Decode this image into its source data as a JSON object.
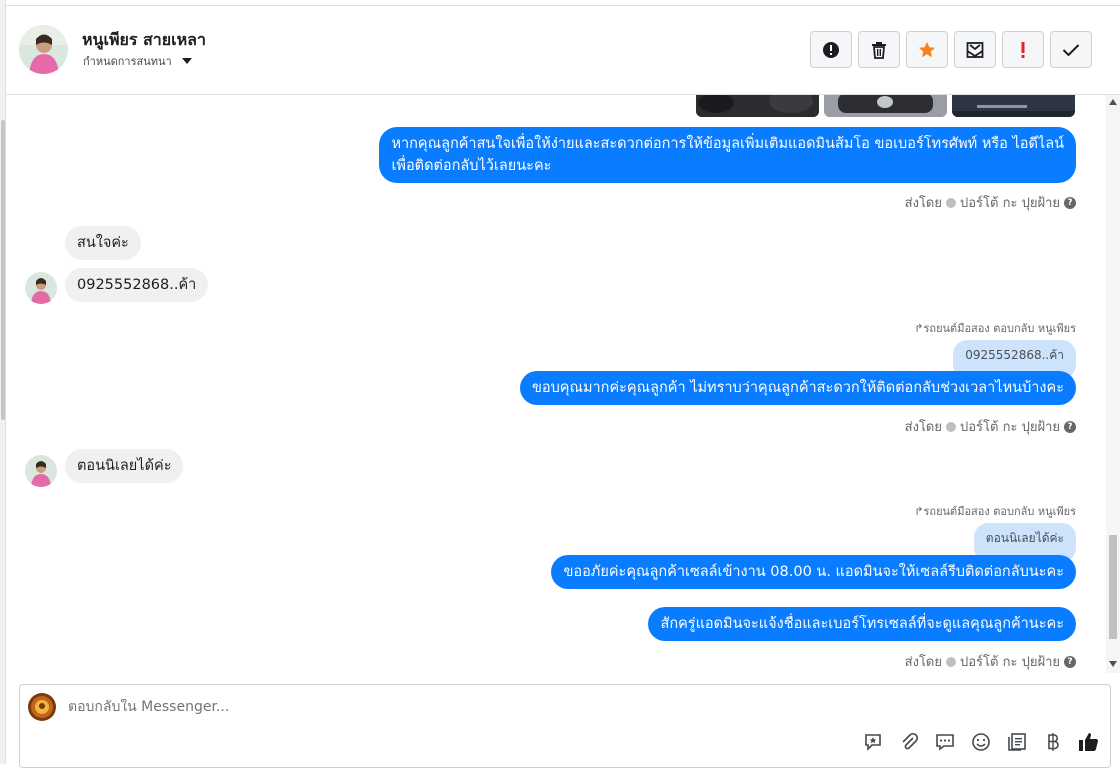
{
  "header": {
    "name": "หนูเพียร สายเหลา",
    "subtitle": "กำหนดการสนทนา",
    "actions": [
      {
        "icon": "alert-circle-icon",
        "label": "mark-spam"
      },
      {
        "icon": "trash-icon",
        "label": "delete"
      },
      {
        "icon": "star-icon",
        "label": "star",
        "color": "#f5821f"
      },
      {
        "icon": "mark-unread-icon",
        "label": "mark-unread"
      },
      {
        "icon": "exclamation-icon",
        "label": "priority",
        "color": "#e02424"
      },
      {
        "icon": "check-icon",
        "label": "done"
      }
    ]
  },
  "messages": {
    "out1": {
      "line1": "หากคุณลูกค้าสนใจเพื่อให้ง่ายและสะดวกต่อการให้ข้อมูลเพิ่มเติมแอดมินส้มโอ ขอเบอร์โทรศัพท์ หรือ ไอดีไลน์",
      "line2": "เพื่อติดต่อกลับไว้เลยนะคะ"
    },
    "sent_by_prefix": "ส่งโดย",
    "sent_by_name": "ปอร์โต้ กะ ปุยฝ้าย",
    "in1": "สนใจค่ะ",
    "in2": "0925552868..ค้า",
    "reply1_meta": "รถยนต์มือสอง ตอบกลับ หนูเพียร",
    "reply1_quote": "0925552868..ค้า",
    "out2": "ขอบคุณมากค่ะคุณลูกค้า ไม่ทราบว่าคุณลูกค้าสะดวกให้ติดต่อกลับช่วงเวลาไหนบ้างคะ",
    "in3": "ตอนนิเลยได้ค่ะ",
    "reply2_meta": "รถยนต์มือสอง ตอบกลับ หนูเพียร",
    "reply2_quote": "ตอนนิเลยได้ค่ะ",
    "out3": "ขออภัยค่ะคุณลูกค้าเซลล์เข้างาน 08.00 น. แอดมินจะให้เซลล์รีบติดต่อกลับนะคะ",
    "out4": "สักครู่แอดมินจะแจ้งชื่อและเบอร์โทรเซลล์ที่จะดูแลคุณลูกค้านะคะ"
  },
  "composer": {
    "placeholder": "ตอบกลับใน Messenger...",
    "icons": [
      "saved-reply-icon",
      "attachment-icon",
      "chat-bubble-icon",
      "emoji-icon",
      "notes-icon",
      "baht-icon",
      "thumbs-up-icon"
    ]
  },
  "colors": {
    "accent": "#0a7cff",
    "incoming": "#f0f0f0",
    "quote": "#cde3fb"
  }
}
